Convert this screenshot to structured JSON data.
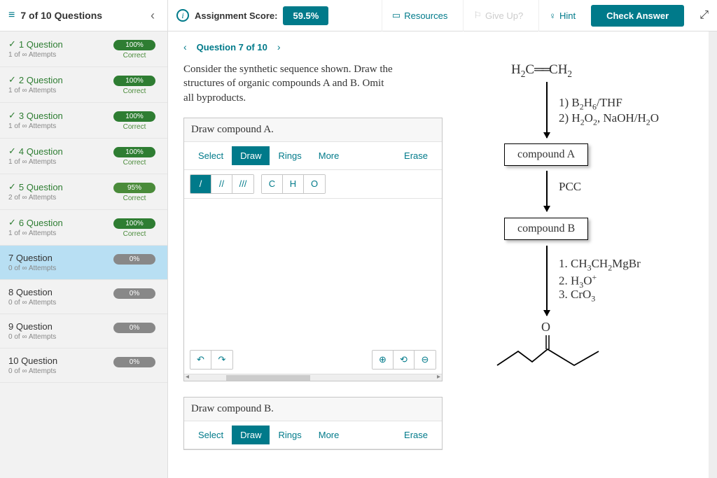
{
  "header": {
    "progress": "7 of 10 Questions",
    "score_label": "Assignment Score:",
    "score_value": "59.5%",
    "resources": "Resources",
    "giveup": "Give Up?",
    "hint": "Hint",
    "check": "Check Answer"
  },
  "nav": {
    "label": "Question 7 of 10"
  },
  "sidebar": [
    {
      "title": "1 Question",
      "attempts": "1 of ∞ Attempts",
      "pct": "100%",
      "status": "Correct",
      "pill": "green",
      "done": true
    },
    {
      "title": "2 Question",
      "attempts": "1 of ∞ Attempts",
      "pct": "100%",
      "status": "Correct",
      "pill": "green",
      "done": true
    },
    {
      "title": "3 Question",
      "attempts": "1 of ∞ Attempts",
      "pct": "100%",
      "status": "Correct",
      "pill": "green",
      "done": true
    },
    {
      "title": "4 Question",
      "attempts": "1 of ∞ Attempts",
      "pct": "100%",
      "status": "Correct",
      "pill": "green",
      "done": true
    },
    {
      "title": "5 Question",
      "attempts": "2 of ∞ Attempts",
      "pct": "95%",
      "status": "Correct",
      "pill": "midgreen",
      "done": true
    },
    {
      "title": "6 Question",
      "attempts": "1 of ∞ Attempts",
      "pct": "100%",
      "status": "Correct",
      "pill": "green",
      "done": true
    },
    {
      "title": "7 Question",
      "attempts": "0 of ∞ Attempts",
      "pct": "0%",
      "status": "",
      "pill": "grey",
      "done": false,
      "active": true
    },
    {
      "title": "8 Question",
      "attempts": "0 of ∞ Attempts",
      "pct": "0%",
      "status": "",
      "pill": "grey",
      "done": false
    },
    {
      "title": "9 Question",
      "attempts": "0 of ∞ Attempts",
      "pct": "0%",
      "status": "",
      "pill": "grey",
      "done": false
    },
    {
      "title": "10 Question",
      "attempts": "0 of ∞ Attempts",
      "pct": "0%",
      "status": "",
      "pill": "grey",
      "done": false
    }
  ],
  "tabs": {
    "select": "Select",
    "draw": "Draw",
    "rings": "Rings",
    "more": "More",
    "erase": "Erase"
  },
  "atoms": {
    "c": "C",
    "h": "H",
    "o": "O"
  },
  "panelA": {
    "title": "Draw compound A."
  },
  "panelB": {
    "title": "Draw compound B."
  },
  "prompt_line1": "Consider the synthetic sequence shown. Draw the",
  "prompt_line2": "structures of organic compounds A and B. Omit",
  "prompt_line3": "all byproducts.",
  "scheme": {
    "top": "H₂C══CH₂",
    "step1a": "1) B₂H₆/THF",
    "step1b": "2) H₂O₂, NaOH/H₂O",
    "boxA": "compound A",
    "pcc": "PCC",
    "boxB": "compound B",
    "step3a": "1. CH₃CH₂MgBr",
    "step3b": "2. H₃O⁺",
    "step3c": "3. CrO₃",
    "O": "O"
  }
}
